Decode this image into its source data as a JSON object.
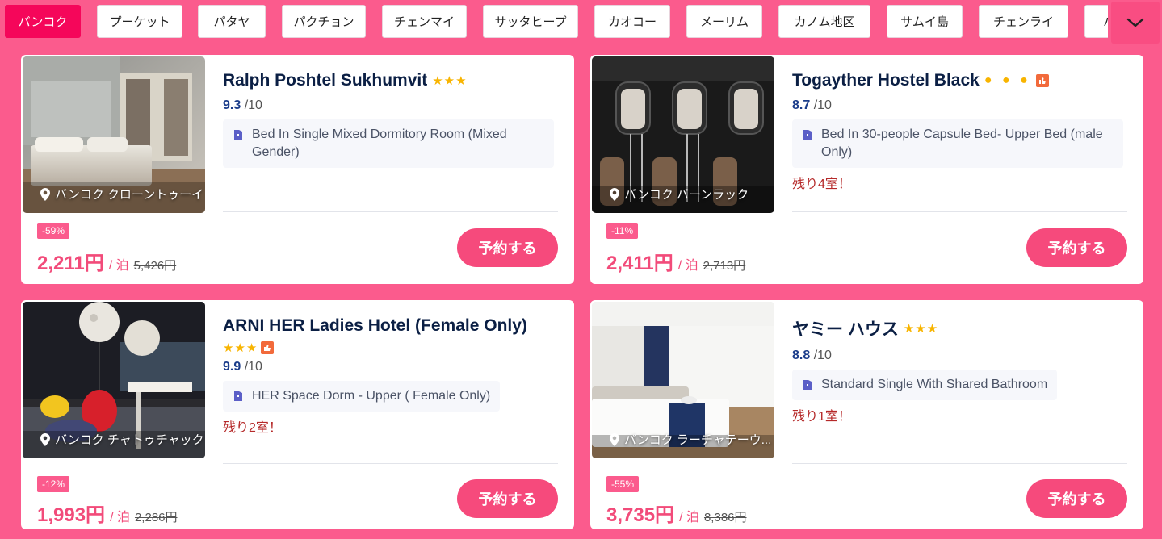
{
  "tabs": [
    {
      "label": "バンコク",
      "active": true
    },
    {
      "label": "プーケット"
    },
    {
      "label": "パタヤ"
    },
    {
      "label": "パクチョン"
    },
    {
      "label": "チェンマイ"
    },
    {
      "label": "サッタヒープ"
    },
    {
      "label": "カオコー"
    },
    {
      "label": "メーリム"
    },
    {
      "label": "カノム地区"
    },
    {
      "label": "サムイ島"
    },
    {
      "label": "チェンライ"
    },
    {
      "label": "ハ"
    }
  ],
  "more_icon": "chevron-down-icon",
  "hotels": [
    {
      "name": "Ralph Poshtel Sukhumvit",
      "stars": "★★★",
      "score": "9.3",
      "score_max": "/10",
      "room": "Bed In Single Mixed Dormitory Room (Mixed Gender)",
      "rooms_left": "",
      "location": "バンコク クローントゥーイ",
      "discount": "-59%",
      "price": "2,211円",
      "per_night": "/ 泊",
      "original_price": "5,426円",
      "book_label": "予約する"
    },
    {
      "name": "Togayther Hostel Black",
      "stars": "● ● ●",
      "score": "8.7",
      "score_max": "/10",
      "room": "Bed In 30-people Capsule Bed- Upper Bed (male Only)",
      "rooms_left": "残り4室！",
      "location": "バンコク バーンラック",
      "discount": "-11%",
      "price": "2,411円",
      "per_night": "/ 泊",
      "original_price": "2,713円",
      "book_label": "予約する"
    },
    {
      "name": "ARNI HER Ladies Hotel (Female Only)",
      "stars": "★★★",
      "score": "9.9",
      "score_max": "/10",
      "room": "HER Space Dorm - Upper ( Female Only)",
      "rooms_left": "残り2室！",
      "location": "バンコク チャトゥチャック",
      "discount": "-12%",
      "price": "1,993円",
      "per_night": "/ 泊",
      "original_price": "2,286円",
      "book_label": "予約する"
    },
    {
      "name": "ヤミー ハウス",
      "stars": "★★★",
      "score": "8.8",
      "score_max": "/10",
      "room": "Standard Single With Shared Bathroom",
      "rooms_left": "残り1室！",
      "location": "バンコク ラーチャテーウ...",
      "discount": "-55%",
      "price": "3,735円",
      "per_night": "/ 泊",
      "original_price": "8,386円",
      "book_label": "予約する"
    }
  ],
  "colors": {
    "page_bg": "#fb5b8d",
    "accent": "#f64a7c",
    "active_tab": "#f5065a",
    "star": "#f8b400",
    "rooms_left": "#b52929"
  }
}
